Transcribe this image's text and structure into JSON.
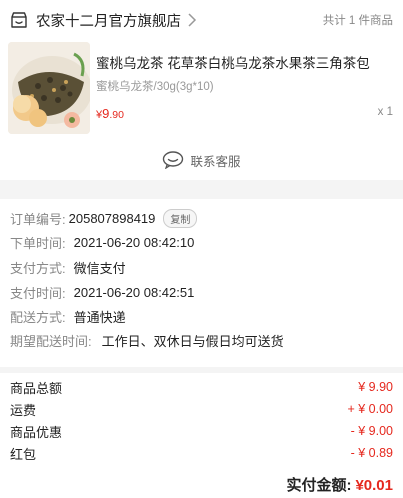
{
  "shop": {
    "name": "农家十二月官方旗舰店",
    "item_count": "共计 1 件商品"
  },
  "product": {
    "title": "蜜桃乌龙茶 花草茶白桃乌龙茶水果茶三角茶包",
    "sku": "蜜桃乌龙茶/30g(3g*10)",
    "price_currency": "¥",
    "price_int": "9",
    "price_dec": ".90",
    "qty": "x 1"
  },
  "service": {
    "label": "联系客服"
  },
  "order": {
    "rows": [
      {
        "label": "订单编号:",
        "value": "205807898419",
        "copy_label": "复制"
      },
      {
        "label": "下单时间:",
        "value": "2021-06-20 08:42:10"
      },
      {
        "label": "支付方式:",
        "value": "微信支付"
      },
      {
        "label": "支付时间:",
        "value": "2021-06-20 08:42:51"
      },
      {
        "label": "配送方式:",
        "value": "普通快递"
      },
      {
        "label": "期望配送时间:",
        "value": "工作日、双休日与假日均可送货"
      }
    ]
  },
  "totals": {
    "rows": [
      {
        "label": "商品总额",
        "value": "¥ 9.90"
      },
      {
        "label": "运费",
        "value": "+ ¥ 0.00"
      },
      {
        "label": "商品优惠",
        "value": "- ¥ 9.00"
      },
      {
        "label": "红包",
        "value": "- ¥ 0.89"
      }
    ],
    "final_label": "实付金额:",
    "final_value": "¥0.01"
  },
  "colors": {
    "accent": "#e5281e",
    "muted": "#888888",
    "bg": "#f4f4f4"
  },
  "icons": {
    "shop": "shop-icon",
    "chevron": "chevron-right-icon",
    "service": "chat-bubble-icon"
  }
}
